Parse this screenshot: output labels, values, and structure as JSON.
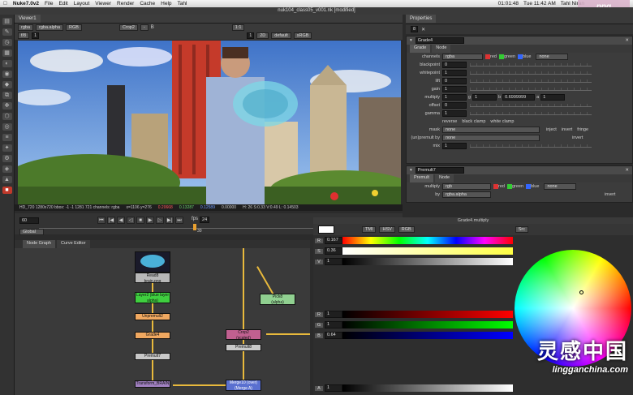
{
  "menubar": {
    "apple": "",
    "app": "Nuke7.0v2",
    "items": [
      "File",
      "Edit",
      "Layout",
      "Viewer",
      "Render",
      "Cache",
      "Help",
      "Tahl"
    ],
    "clock": "01:01:48",
    "date": "Tue 11:42 AM",
    "user": "Tahl Niran"
  },
  "window_title": "nuk104_class05_v001.nk [modified]",
  "watermark_top": "png",
  "viewer": {
    "tab": "Viewer1",
    "channels": "rgba",
    "alpha": "rgba.alpha",
    "rgb": "RGB",
    "a_input": "Crop2",
    "b_input": "-",
    "b_label": "B",
    "gain_label": "1/8",
    "gain_value": "1",
    "fstop": "f/8",
    "zoom": "1:1",
    "proxy": "2D",
    "lut": "default",
    "colorspace": "sRGB",
    "info": "HD_720  1280x720  bbox: -1 -1 1281 721  channels: rgba",
    "coords": "x=1106 y=276",
    "pixel": {
      "r": "0.20668",
      "g": "0.13287",
      "b": "0.12589",
      "a": "0.00000"
    },
    "hsvl": "H: 26 S:0.33 V:0.49  L: 0.14503"
  },
  "timeline": {
    "frame": "60",
    "fps_label": "fps",
    "fps": "24",
    "mode": "Global",
    "marker": "30"
  },
  "nodegraph": {
    "tabs": [
      "Node Graph",
      "Curve Editor"
    ],
    "nodes": {
      "read": "Read8\nbrain.png",
      "shuffle": "Layer2 (blue layer alpha)",
      "unpremult": "Unpremult2",
      "grade": "Grade4",
      "premult7": "Premult7",
      "transform": "Transform_BRAIN",
      "crop": "Crop2\n(scaled)",
      "premult8": "Premult8",
      "pickl": "Pick8\n(alpha)",
      "merge": "Merge10 (over)\n(Merge A)"
    }
  },
  "properties": {
    "title": "Properties",
    "count": "8",
    "grade": {
      "name": "Grade4",
      "tabs": [
        "Grade",
        "Node"
      ],
      "channels": "rgba",
      "ch_r": "red",
      "ch_g": "green",
      "ch_b": "blue",
      "ch_none": "none",
      "rows": [
        {
          "label": "blackpoint",
          "value": "0"
        },
        {
          "label": "whitepoint",
          "value": "1"
        },
        {
          "label": "lift",
          "value": "0"
        },
        {
          "label": "gain",
          "value": "1"
        }
      ],
      "multiply": {
        "label": "multiply",
        "r": "1",
        "g_label": "g",
        "g": "1",
        "b_label": "b",
        "b": "0.6999999",
        "a_label": "a",
        "a": "1"
      },
      "offset": {
        "label": "offset",
        "value": "0"
      },
      "gamma": {
        "label": "gamma",
        "value": "1"
      },
      "reverse": "reverse",
      "black_clamp": "black clamp",
      "white_clamp": "white clamp",
      "mask_label": "mask",
      "mask_value": "none",
      "inject": "inject",
      "invert": "invert",
      "fringe": "fringe",
      "unpremult_label": "(un)premult by",
      "unpremult_value": "none",
      "invert2": "invert",
      "mix_label": "mix",
      "mix_value": "1"
    },
    "premult": {
      "name": "Premult7",
      "tabs": [
        "Premult",
        "Node"
      ],
      "multiply_label": "multiply",
      "multiply": "rgb",
      "r": "red",
      "g": "green",
      "b": "blue",
      "none": "none",
      "by_label": "by",
      "by": "rgba.alpha",
      "invert": "invert"
    }
  },
  "curve": {
    "title": "Grade4.multiply",
    "buttons": [
      "TMI",
      "HSV",
      "RGB"
    ],
    "mode": "Src",
    "rows": [
      {
        "ch": "R",
        "v": "0.167"
      },
      {
        "ch": "S",
        "v": "0.36"
      },
      {
        "ch": "V",
        "v": "1"
      },
      {
        "ch": "R",
        "v": "1"
      },
      {
        "ch": "G",
        "v": "1"
      },
      {
        "ch": "B",
        "v": "0.64"
      },
      {
        "ch": "A",
        "v": "1"
      }
    ]
  },
  "watermark": {
    "cn": "灵感中国",
    "url": "lingganchina.com"
  },
  "colors": {
    "accent": "#e8b93c",
    "grade_node": "#f0a860",
    "read_node": "#b8b8b8",
    "shuffle_node": "#3fcf3f",
    "crop_node": "#c06090",
    "merge_node": "#5a70d0",
    "pick_node": "#90d090"
  }
}
